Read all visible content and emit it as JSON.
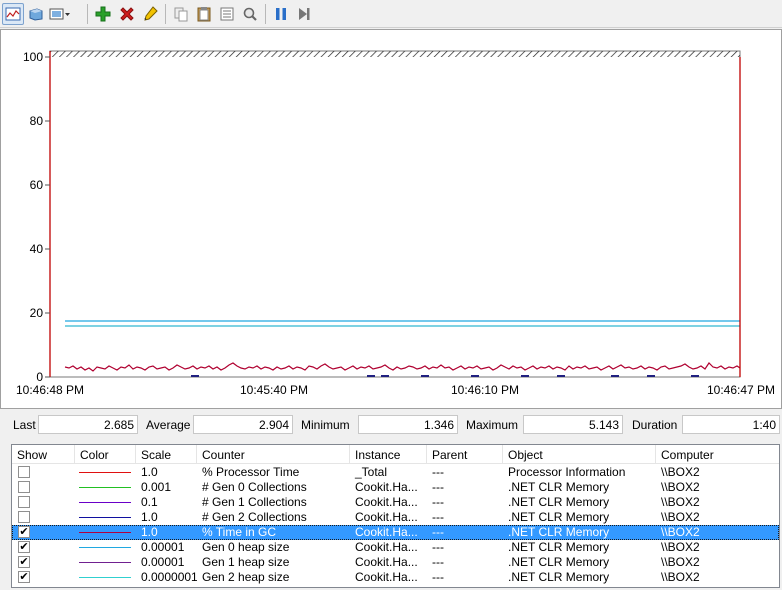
{
  "toolbar": {
    "buttons": [
      {
        "icon": "view-graph-icon",
        "active": true
      },
      {
        "icon": "view-histogram-icon"
      },
      {
        "icon": "change-graph-type-icon"
      },
      {
        "icon": "add-counter-icon",
        "color": "#2aa02a"
      },
      {
        "icon": "delete-counter-icon",
        "color": "#d11f1f"
      },
      {
        "icon": "highlight-icon",
        "color": "#e2b400"
      },
      {
        "icon": "copy-properties-icon"
      },
      {
        "icon": "paste-counter-list-icon"
      },
      {
        "icon": "properties-icon"
      },
      {
        "icon": "zoom-icon"
      },
      {
        "icon": "freeze-display-icon",
        "color": "#2a6fc9"
      },
      {
        "icon": "update-data-icon"
      }
    ]
  },
  "graph": {
    "y_ticks": [
      "100",
      "80",
      "60",
      "40",
      "20",
      "0"
    ],
    "x_ticks": [
      "10:46:48 PM",
      "10:45:40 PM",
      "10:46:10 PM",
      "10:46:47 PM"
    ],
    "current_line_color": "#c00000"
  },
  "stats": {
    "last_label": "Last",
    "last_value": "2.685",
    "average_label": "Average",
    "average_value": "2.904",
    "minimum_label": "Minimum",
    "minimum_value": "1.346",
    "maximum_label": "Maximum",
    "maximum_value": "5.143",
    "duration_label": "Duration",
    "duration_value": "1:40"
  },
  "list": {
    "headers": [
      "Show",
      "Color",
      "Scale",
      "Counter",
      "Instance",
      "Parent",
      "Object",
      "Computer"
    ],
    "rows": [
      {
        "checked": false,
        "color": "#e01010",
        "scale": "1.0",
        "counter": "% Processor Time",
        "instance": "_Total",
        "parent": "---",
        "object": "Processor Information",
        "computer": "\\\\BOX2"
      },
      {
        "checked": false,
        "color": "#22c022",
        "scale": "0.001",
        "counter": "# Gen 0 Collections",
        "instance": "Cookit.Ha...",
        "parent": "---",
        "object": ".NET CLR Memory",
        "computer": "\\\\BOX2"
      },
      {
        "checked": false,
        "color": "#6a00c8",
        "scale": "0.1",
        "counter": "# Gen 1 Collections",
        "instance": "Cookit.Ha...",
        "parent": "---",
        "object": ".NET CLR Memory",
        "computer": "\\\\BOX2"
      },
      {
        "checked": false,
        "color": "#1010a0",
        "scale": "1.0",
        "counter": "# Gen 2 Collections",
        "instance": "Cookit.Ha...",
        "parent": "---",
        "object": ".NET CLR Memory",
        "computer": "\\\\BOX2"
      },
      {
        "checked": true,
        "selected": true,
        "color": "#b00040",
        "scale": "1.0",
        "counter": "% Time in GC",
        "instance": "Cookit.Ha...",
        "parent": "---",
        "object": ".NET CLR Memory",
        "computer": "\\\\BOX2"
      },
      {
        "checked": true,
        "color": "#20a8e0",
        "scale": "0.00001",
        "counter": "Gen 0 heap size",
        "instance": "Cookit.Ha...",
        "parent": "---",
        "object": ".NET CLR Memory",
        "computer": "\\\\BOX2"
      },
      {
        "checked": true,
        "color": "#702090",
        "scale": "0.00001",
        "counter": "Gen 1 heap size",
        "instance": "Cookit.Ha...",
        "parent": "---",
        "object": ".NET CLR Memory",
        "computer": "\\\\BOX2"
      },
      {
        "checked": true,
        "color": "#30d0d0",
        "scale": "0.0000001",
        "counter": "Gen 2 heap size",
        "instance": "Cookit.Ha...",
        "parent": "---",
        "object": ".NET CLR Memory",
        "computer": "\\\\BOX2"
      }
    ]
  }
}
